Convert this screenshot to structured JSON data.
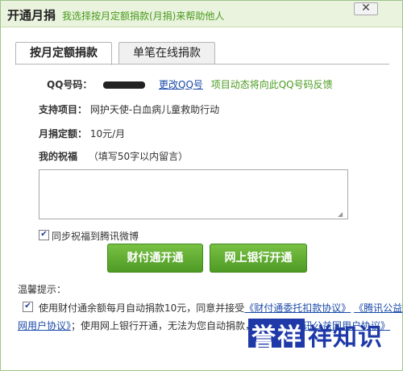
{
  "title": {
    "main": "开通月捐",
    "sub": "我选择按月定额捐款(月捐)来帮助他人"
  },
  "close_label": "✕",
  "tabs": [
    {
      "label": "按月定额捐款"
    },
    {
      "label": "单笔在线捐款"
    }
  ],
  "qq": {
    "label": "QQ号码：",
    "change_link": "更改QQ号",
    "note": "项目动态将向此QQ号码反馈"
  },
  "project": {
    "label": "支持项目：",
    "value": "网护天使-白血病儿童救助行动"
  },
  "monthly": {
    "label": "月捐定额：",
    "value": "10元/月"
  },
  "blessing": {
    "label": "我的祝福",
    "hint": "（填写50字以内留言）",
    "text": ""
  },
  "sync": {
    "checked": true,
    "label": "同步祝福到腾讯微博"
  },
  "buttons": {
    "tenpay": "财付通开通",
    "bank": "网上银行开通"
  },
  "tips": {
    "title": "温馨提示：",
    "checked": true,
    "text1": "使用财付通余额每月自动捐款10元，同意并接受",
    "link1": "《财付通委托扣款协议》",
    "link2": "《腾讯公益网用户协议》",
    "text2": "；使用网上银行开通，无法为您自动捐款，并接受",
    "link3": "《腾讯公益网用户协议》"
  },
  "watermark": {
    "part1": "誉",
    "part2": "祥",
    "part3": "祥知识"
  },
  "colors": {
    "accent_green": "#4a9a1e",
    "title_bg": "#e9f3dd",
    "link_blue": "#1a4aa8",
    "button_green": "#5aa82e"
  }
}
